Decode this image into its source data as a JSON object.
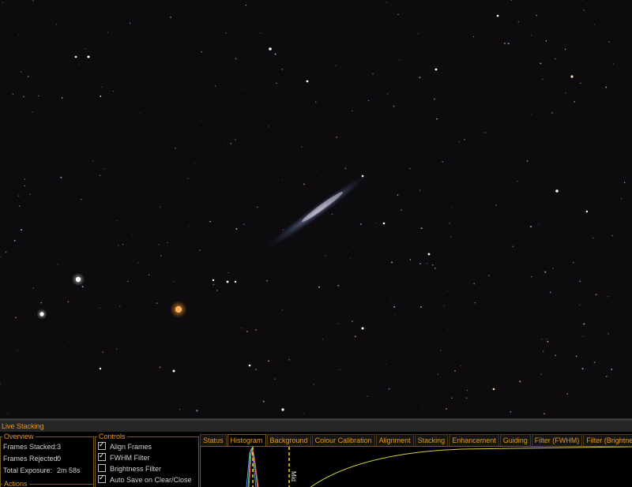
{
  "panel": {
    "title": "Live Stacking",
    "overview": {
      "legend": "Overview",
      "frames_stacked_label": "Frames Stacked:",
      "frames_stacked_value": "3",
      "frames_rejected_label": "Frames Rejected:",
      "frames_rejected_value": "0",
      "total_exposure_label": "Total Exposure:",
      "total_exposure_value": "2m 58s"
    },
    "actions": {
      "legend": "Actions"
    },
    "controls": {
      "legend": "Controls",
      "items": [
        {
          "label": "Align Frames",
          "checked": true
        },
        {
          "label": "FWHM Filter",
          "checked": true
        },
        {
          "label": "Brightness Filter",
          "checked": false
        },
        {
          "label": "Auto Save on Clear/Close",
          "checked": true
        }
      ]
    },
    "tabs": [
      {
        "label": "Status",
        "active": false
      },
      {
        "label": "Histogram",
        "active": true
      },
      {
        "label": "Background",
        "active": false
      },
      {
        "label": "Colour Calibration",
        "active": false
      },
      {
        "label": "Alignment",
        "active": false
      },
      {
        "label": "Stacking",
        "active": false
      },
      {
        "label": "Enhancement",
        "active": false
      },
      {
        "label": "Guiding",
        "active": false
      },
      {
        "label": "Filter (FWHM)",
        "active": false
      },
      {
        "label": "Filter (Brightness)",
        "active": false
      }
    ],
    "histogram": {
      "marker_label": "Mid"
    }
  },
  "colors": {
    "accent": "#e89a1f",
    "background": "#0d0b0e",
    "curve": "#d6d63a",
    "marker": "#f0e000"
  }
}
